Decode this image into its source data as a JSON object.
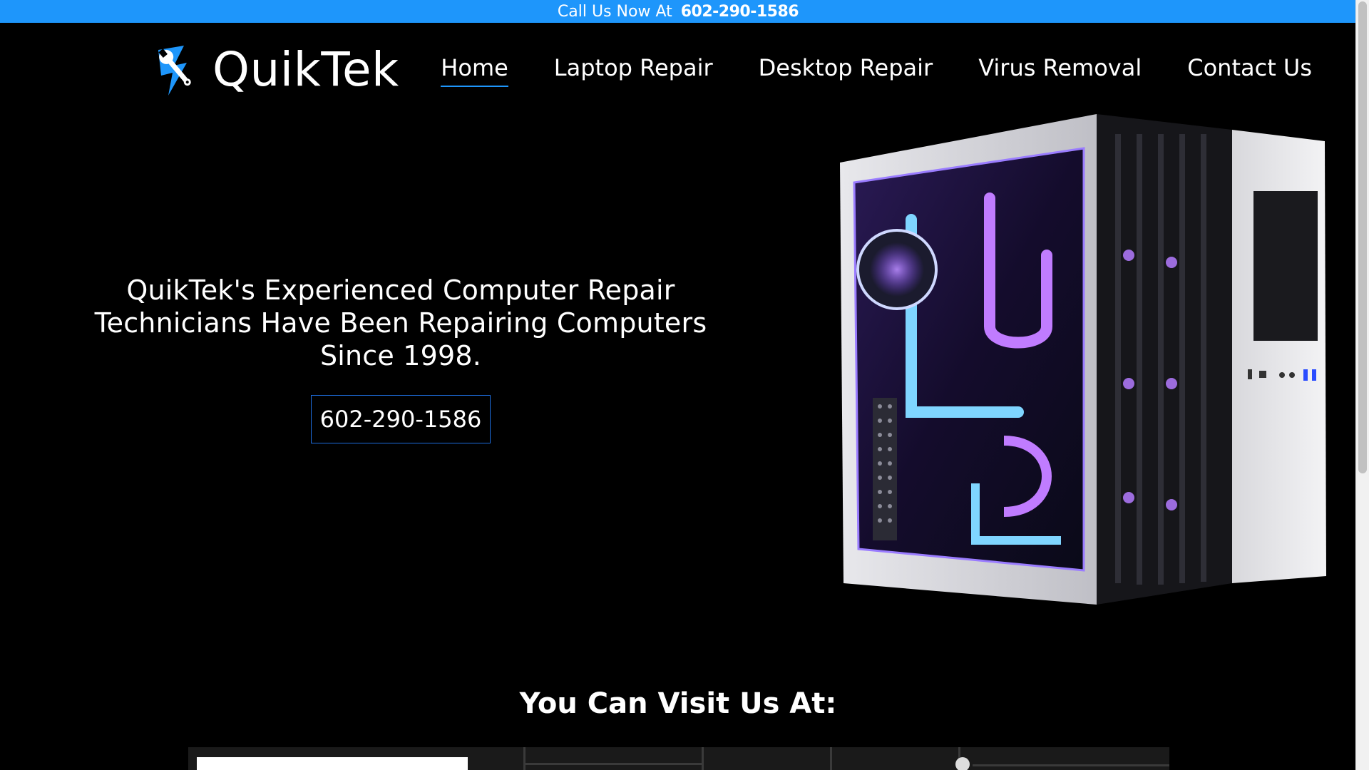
{
  "topbar": {
    "prefix": "Call Us Now At",
    "phone": "602-290-1586"
  },
  "brand": {
    "name": "QuikTek",
    "icon": "wrench-lightning-icon"
  },
  "nav": {
    "items": [
      {
        "label": "Home",
        "active": true
      },
      {
        "label": "Laptop Repair",
        "active": false
      },
      {
        "label": "Desktop Repair",
        "active": false
      },
      {
        "label": "Virus Removal",
        "active": false
      },
      {
        "label": "Contact Us",
        "active": false
      }
    ]
  },
  "hero": {
    "headline": "QuikTek's Experienced Computer Repair Technicians Have Been Repairing Computers Since 1998.",
    "cta_phone": "602-290-1586",
    "image_icon": "gaming-pc-case-image"
  },
  "visit": {
    "title": "You Can Visit Us At:"
  },
  "colors": {
    "accent": "#1e96fb",
    "background": "#000000"
  }
}
